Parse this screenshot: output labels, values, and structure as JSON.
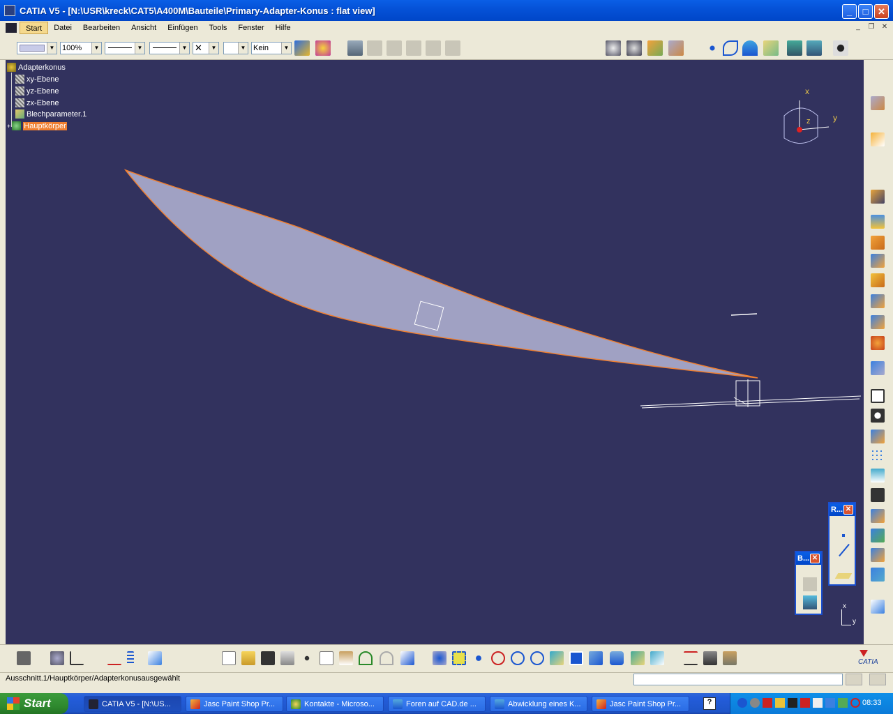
{
  "window": {
    "title": "CATIA V5 - [N:\\USR\\kreck\\CAT5\\A400M\\Bauteile\\Primary-Adapter-Konus : flat view]",
    "minimize": "_",
    "maximize": "□",
    "close": "✕"
  },
  "menu": {
    "items": [
      "Start",
      "Datei",
      "Bearbeiten",
      "Ansicht",
      "Einfügen",
      "Tools",
      "Fenster",
      "Hilfe"
    ]
  },
  "mdi": {
    "minimize": "_",
    "restore": "❐",
    "close": "✕"
  },
  "toolbar": {
    "zoom": "100%",
    "layer": "Kein"
  },
  "tree": {
    "root": "Adapterkonus",
    "children": [
      "xy-Ebene",
      "yz-Ebene",
      "zx-Ebene",
      "Blechparameter.1",
      "Hauptkörper"
    ],
    "selected": "Hauptkörper"
  },
  "compass": {
    "x": "x",
    "y": "y",
    "z": "z"
  },
  "axis_small": {
    "x": "x",
    "y": "y"
  },
  "palettes": {
    "p1": {
      "title": "R..."
    },
    "p2": {
      "title": "B..."
    }
  },
  "status": {
    "text": "Ausschnitt.1/Hauptkörper/Adapterkonusausgewählt",
    "input": ""
  },
  "taskbar": {
    "start": "Start",
    "tasks": [
      {
        "label": "CATIA V5 - [N:\\US...",
        "active": true
      },
      {
        "label": "Jasc Paint Shop Pr...",
        "active": false
      },
      {
        "label": "Kontakte - Microso...",
        "active": false
      },
      {
        "label": "Foren auf CAD.de ...",
        "active": false
      },
      {
        "label": "Abwicklung eines K...",
        "active": false
      },
      {
        "label": "Jasc Paint Shop Pr...",
        "active": false
      }
    ],
    "clock": "08:33"
  },
  "colors": {
    "viewport": "#32325E",
    "part_fill": "#A0A1C3",
    "part_edge": "#F07F30",
    "selection": "#F07F30",
    "titlebar": "#0A5FE6"
  }
}
